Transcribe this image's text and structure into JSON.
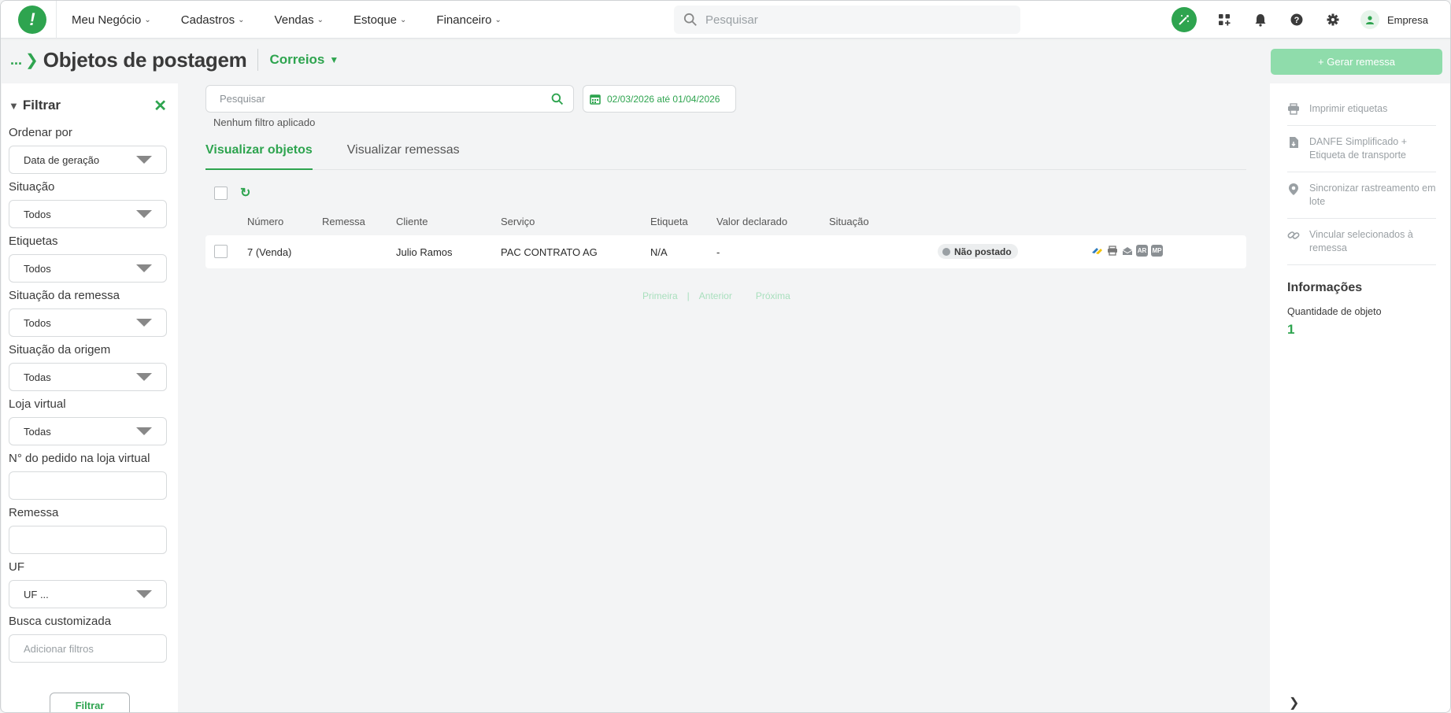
{
  "nav": {
    "logo_glyph": "!",
    "menu": [
      {
        "label": "Meu Negócio"
      },
      {
        "label": "Cadastros"
      },
      {
        "label": "Vendas"
      },
      {
        "label": "Estoque"
      },
      {
        "label": "Financeiro"
      }
    ],
    "search_placeholder": "Pesquisar",
    "user_label": "Empresa",
    "icons": [
      "magic-wand-icon",
      "apps-icon",
      "bell-icon",
      "help-icon",
      "gear-icon",
      "user-icon"
    ]
  },
  "header": {
    "breadcrumb": "...",
    "title": "Objetos de postagem",
    "carrier": "Correios",
    "generate_button": "+ Gerar remessa"
  },
  "filter": {
    "title": "Filtrar",
    "fields": {
      "order_label": "Ordenar por",
      "order_value": "Data de geração",
      "situation_label": "Situação",
      "situation_value": "Todos",
      "labels_label": "Etiquetas",
      "labels_value": "Todos",
      "shipment_situation_label": "Situação da remessa",
      "shipment_situation_value": "Todos",
      "origin_situation_label": "Situação da origem",
      "origin_situation_value": "Todas",
      "store_label": "Loja virtual",
      "store_value": "Todas",
      "order_number_label": "N° do pedido na loja virtual",
      "shipment_label": "Remessa",
      "uf_label": "UF",
      "uf_value": "UF ...",
      "custom_search_label": "Busca customizada",
      "custom_search_placeholder": "Adicionar filtros"
    },
    "button": "Filtrar"
  },
  "main": {
    "search_placeholder": "Pesquisar",
    "date_range": "02/03/2026 até 01/04/2026",
    "no_filter": "Nenhum filtro aplicado",
    "tabs": [
      {
        "label": "Visualizar objetos",
        "active": true
      },
      {
        "label": "Visualizar remessas",
        "active": false
      }
    ],
    "columns": [
      "Número",
      "Remessa",
      "Cliente",
      "Serviço",
      "Etiqueta",
      "Valor declarado",
      "Situação"
    ],
    "rows": [
      {
        "numero": "7 (Venda)",
        "remessa": "",
        "cliente": "Julio Ramos",
        "servico": "PAC CONTRATO AG",
        "etiqueta": "N/A",
        "valor": "-",
        "situacao": "Não postado"
      }
    ],
    "row_actions": [
      {
        "icon": "correios-icon",
        "text": ""
      },
      {
        "icon": "print-icon",
        "text": ""
      },
      {
        "icon": "envelope-icon",
        "text": ""
      },
      {
        "icon": "ar-icon",
        "text": "AR"
      },
      {
        "icon": "mp-icon",
        "text": "MP"
      }
    ],
    "pager": {
      "first": "Primeira",
      "sep": "|",
      "prev": "Anterior",
      "next": "Próxima"
    }
  },
  "right_panel": {
    "actions": [
      {
        "label": "Imprimir etiquetas",
        "icon": "print-icon"
      },
      {
        "label": "DANFE Simplificado + Etiqueta de transporte",
        "icon": "document-icon"
      },
      {
        "label": "Sincronizar rastreamento em lote",
        "icon": "location-pin-icon"
      },
      {
        "label": "Vincular selecionados à remessa",
        "icon": "link-icon"
      }
    ],
    "info_title": "Informações",
    "quantity_label": "Quantidade de objeto",
    "quantity_value": "1"
  },
  "colors": {
    "brand_green": "#2ea44f",
    "light_green": "#8fdcab"
  }
}
